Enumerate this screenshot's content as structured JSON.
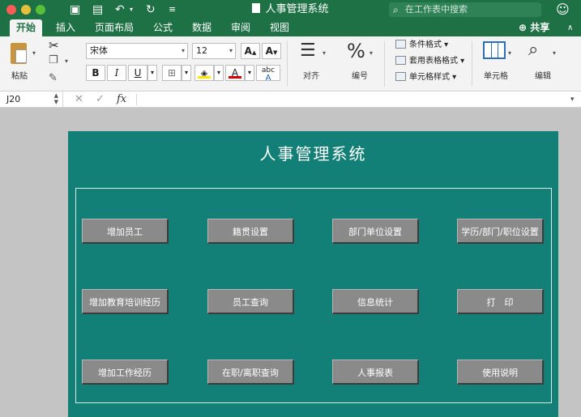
{
  "window": {
    "title": "人事管理系统",
    "search_placeholder": "在工作表中搜索"
  },
  "tabs": [
    "开始",
    "插入",
    "页面布局",
    "公式",
    "数据",
    "审阅",
    "视图"
  ],
  "share_label": "共享",
  "ribbon": {
    "paste_label": "粘贴",
    "font_name": "宋体",
    "font_size": "12",
    "bold": "B",
    "italic": "I",
    "underline": "U",
    "grow_font": "A",
    "shrink_font": "A",
    "font_color_letter": "A",
    "fill_color_hex": "#ffe600",
    "font_color_hex": "#d40000",
    "abc_label": "abc",
    "align_label": "对齐",
    "number_label": "编号",
    "percent_symbol": "%",
    "cond_format": "条件格式",
    "table_format": "套用表格格式",
    "cell_style": "单元格样式",
    "cells_label": "单元格",
    "edit_label": "编辑"
  },
  "formula_bar": {
    "cell_ref": "J20",
    "fx": "fx",
    "value": ""
  },
  "panel": {
    "title": "人事管理系统",
    "bg_color": "#128077",
    "buttons": [
      [
        "增加员工",
        "籍贯设置",
        "部门单位设置",
        "学历/部门/职位设置"
      ],
      [
        "增加教育培训经历",
        "员工查询",
        "信息统计",
        "打　印"
      ],
      [
        "增加工作经历",
        "在职/离职查询",
        "人事报表",
        "使用说明"
      ]
    ]
  }
}
